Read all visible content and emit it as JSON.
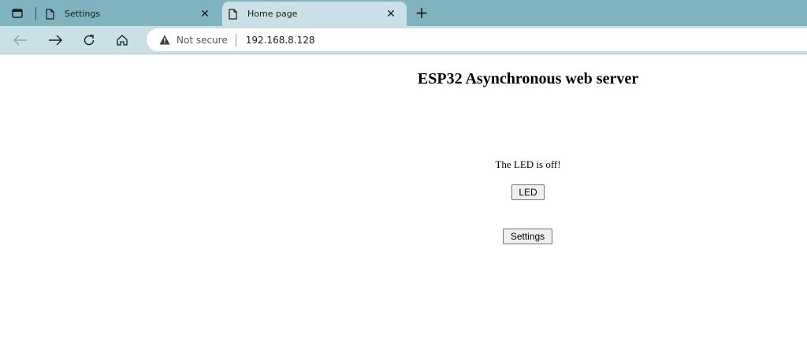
{
  "browser": {
    "tabs": [
      {
        "title": "Settings",
        "close": "✕"
      },
      {
        "title": "Home page",
        "close": "✕"
      }
    ],
    "new_tab": "+",
    "address": {
      "security": "Not secure",
      "url": "192.168.8.128"
    },
    "icons": [
      "window-icon",
      "page-icon",
      "back-icon",
      "forward-icon",
      "reload-icon",
      "home-icon",
      "warning-icon"
    ]
  },
  "page": {
    "title": "ESP32 Asynchronous web server",
    "led_status": "The LED is off!",
    "led_button": "LED",
    "settings_button": "Settings"
  }
}
